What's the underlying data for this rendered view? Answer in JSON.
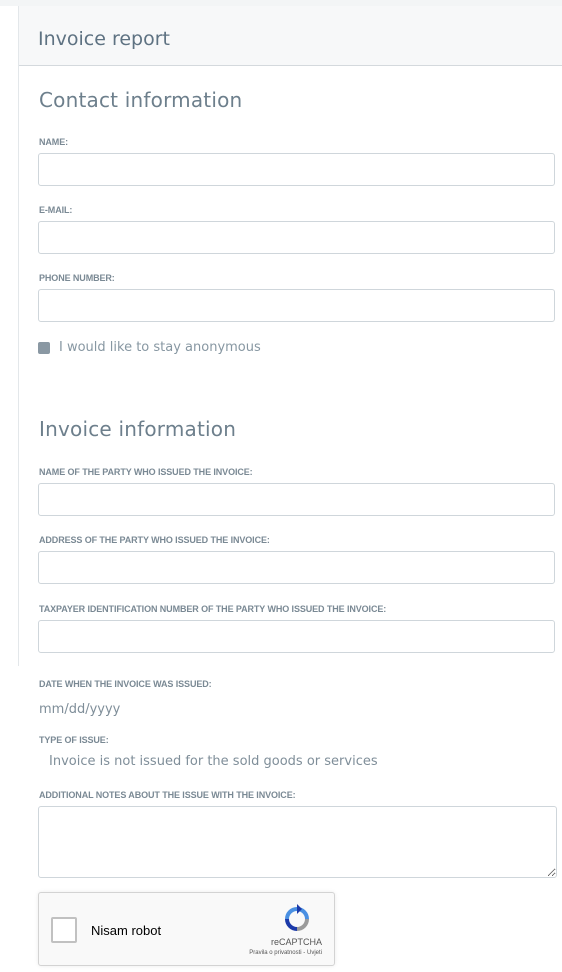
{
  "header": {
    "title": "Invoice report"
  },
  "contact": {
    "title": "Contact information",
    "name_label": "NAME:",
    "email_label": "E-MAIL:",
    "phone_label": "PHONE NUMBER:",
    "anonymous_label": "I would like to stay anonymous",
    "anonymous_checked": false
  },
  "invoice": {
    "title": "Invoice information",
    "issuer_name_label": "NAME OF THE PARTY WHO ISSUED THE INVOICE:",
    "issuer_address_label": "ADDRESS OF THE PARTY WHO ISSUED THE INVOICE:",
    "issuer_tin_label": "TAXPAYER IDENTIFICATION NUMBER OF THE PARTY WHO ISSUED THE INVOICE:",
    "date_label": "DATE WHEN THE INVOICE WAS ISSUED:",
    "date_placeholder": "mm/dd/yyyy",
    "issue_type_label": "TYPE OF ISSUE:",
    "issue_type_value": "Invoice is not issued for the sold goods or services",
    "notes_label": "ADDITIONAL NOTES ABOUT THE ISSUE WITH THE INVOICE:"
  },
  "recaptcha": {
    "label": "Nisam robot",
    "brand": "reCAPTCHA",
    "privacy_link": "Pravila o privatnosti",
    "separator": " - ",
    "terms_link": "Uvjeti"
  },
  "colors": {
    "text": "#6b7c89",
    "border": "#cfd6db",
    "header_bg": "#f7f8f9",
    "checkbox": "#8a98a3"
  }
}
